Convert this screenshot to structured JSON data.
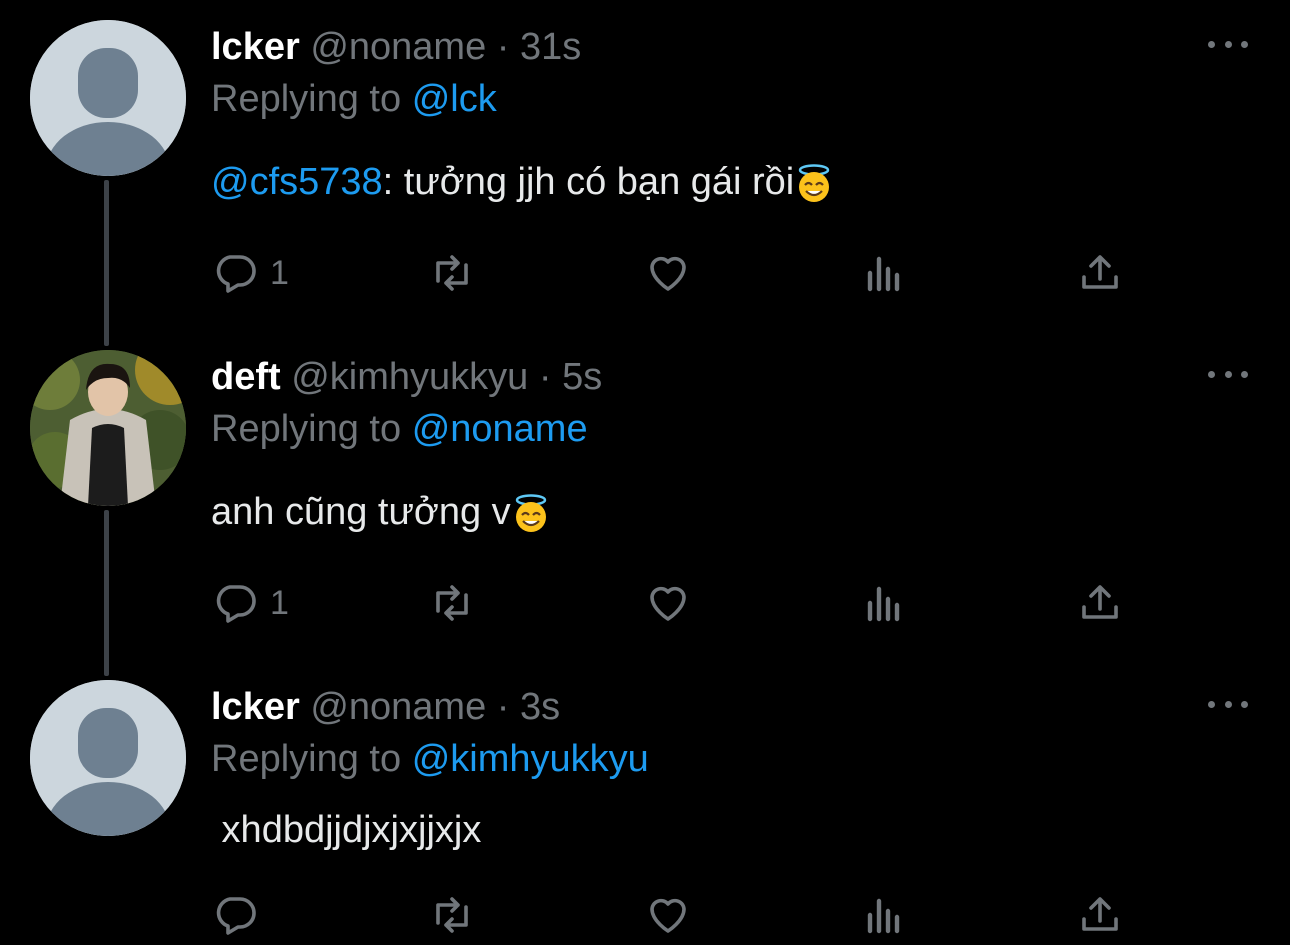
{
  "tweets": [
    {
      "display_name": "lcker",
      "handle": "@noname",
      "separator": "·",
      "time": "31s",
      "replying_prefix": "Replying to",
      "replying_to": "@lck",
      "body_mention": "@cfs5738",
      "body_text": ": tưởng jjh có bạn gái rồi",
      "emoji": "smiling-face-with-halo",
      "reply_count": "1",
      "avatar": "default-avatar"
    },
    {
      "display_name": "deft",
      "handle": "@kimhyukkyu",
      "separator": "·",
      "time": "5s",
      "replying_prefix": "Replying to",
      "replying_to": "@noname",
      "body_text": "anh cũng tưởng v",
      "emoji": "smiling-face-with-halo",
      "reply_count": "1",
      "avatar": "profile-photo"
    },
    {
      "display_name": "lcker",
      "handle": "@noname",
      "separator": "·",
      "time": "3s",
      "replying_prefix": "Replying to",
      "replying_to": "@kimhyukkyu",
      "body_text": " xhdbdjjdjxjxjjxjx",
      "reply_count": "",
      "avatar": "default-avatar"
    }
  ],
  "colors": {
    "background": "#000000",
    "text": "#e7e9ea",
    "muted": "#71767b",
    "accent": "#1d9bf0",
    "thread_line": "#3d4248",
    "default_avatar_bg": "#ccd6dd",
    "default_avatar_fg": "#6e8091"
  },
  "icons": [
    "reply-icon",
    "retweet-icon",
    "like-icon",
    "views-icon",
    "share-icon",
    "more-icon"
  ]
}
